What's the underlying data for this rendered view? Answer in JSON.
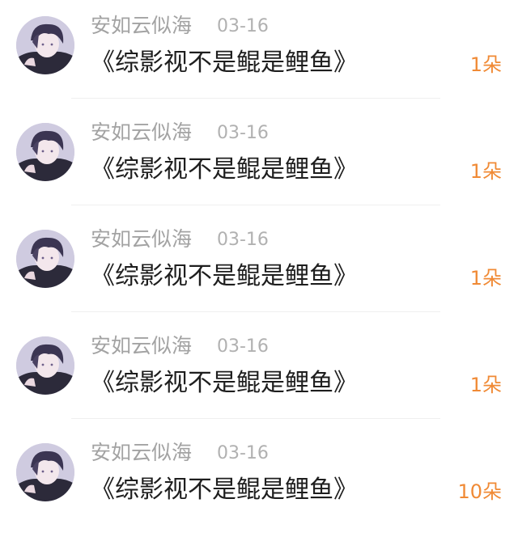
{
  "comments": [
    {
      "username": "安如云似海",
      "date": "03-16",
      "message": "《综影视不是鲲是鲤鱼》",
      "count": "1朵"
    },
    {
      "username": "安如云似海",
      "date": "03-16",
      "message": "《综影视不是鲲是鲤鱼》",
      "count": "1朵"
    },
    {
      "username": "安如云似海",
      "date": "03-16",
      "message": "《综影视不是鲲是鲤鱼》",
      "count": "1朵"
    },
    {
      "username": "安如云似海",
      "date": "03-16",
      "message": "《综影视不是鲲是鲤鱼》",
      "count": "1朵"
    },
    {
      "username": "安如云似海",
      "date": "03-16",
      "message": "《综影视不是鲲是鲤鱼》",
      "count": "10朵"
    }
  ],
  "colors": {
    "username": "#a3a3a3",
    "date": "#b1b1b1",
    "message": "#1e1e1e",
    "count": "#f08a35",
    "divider": "#efefef"
  },
  "icons": {
    "avatar": "anime-boy-avatar"
  }
}
